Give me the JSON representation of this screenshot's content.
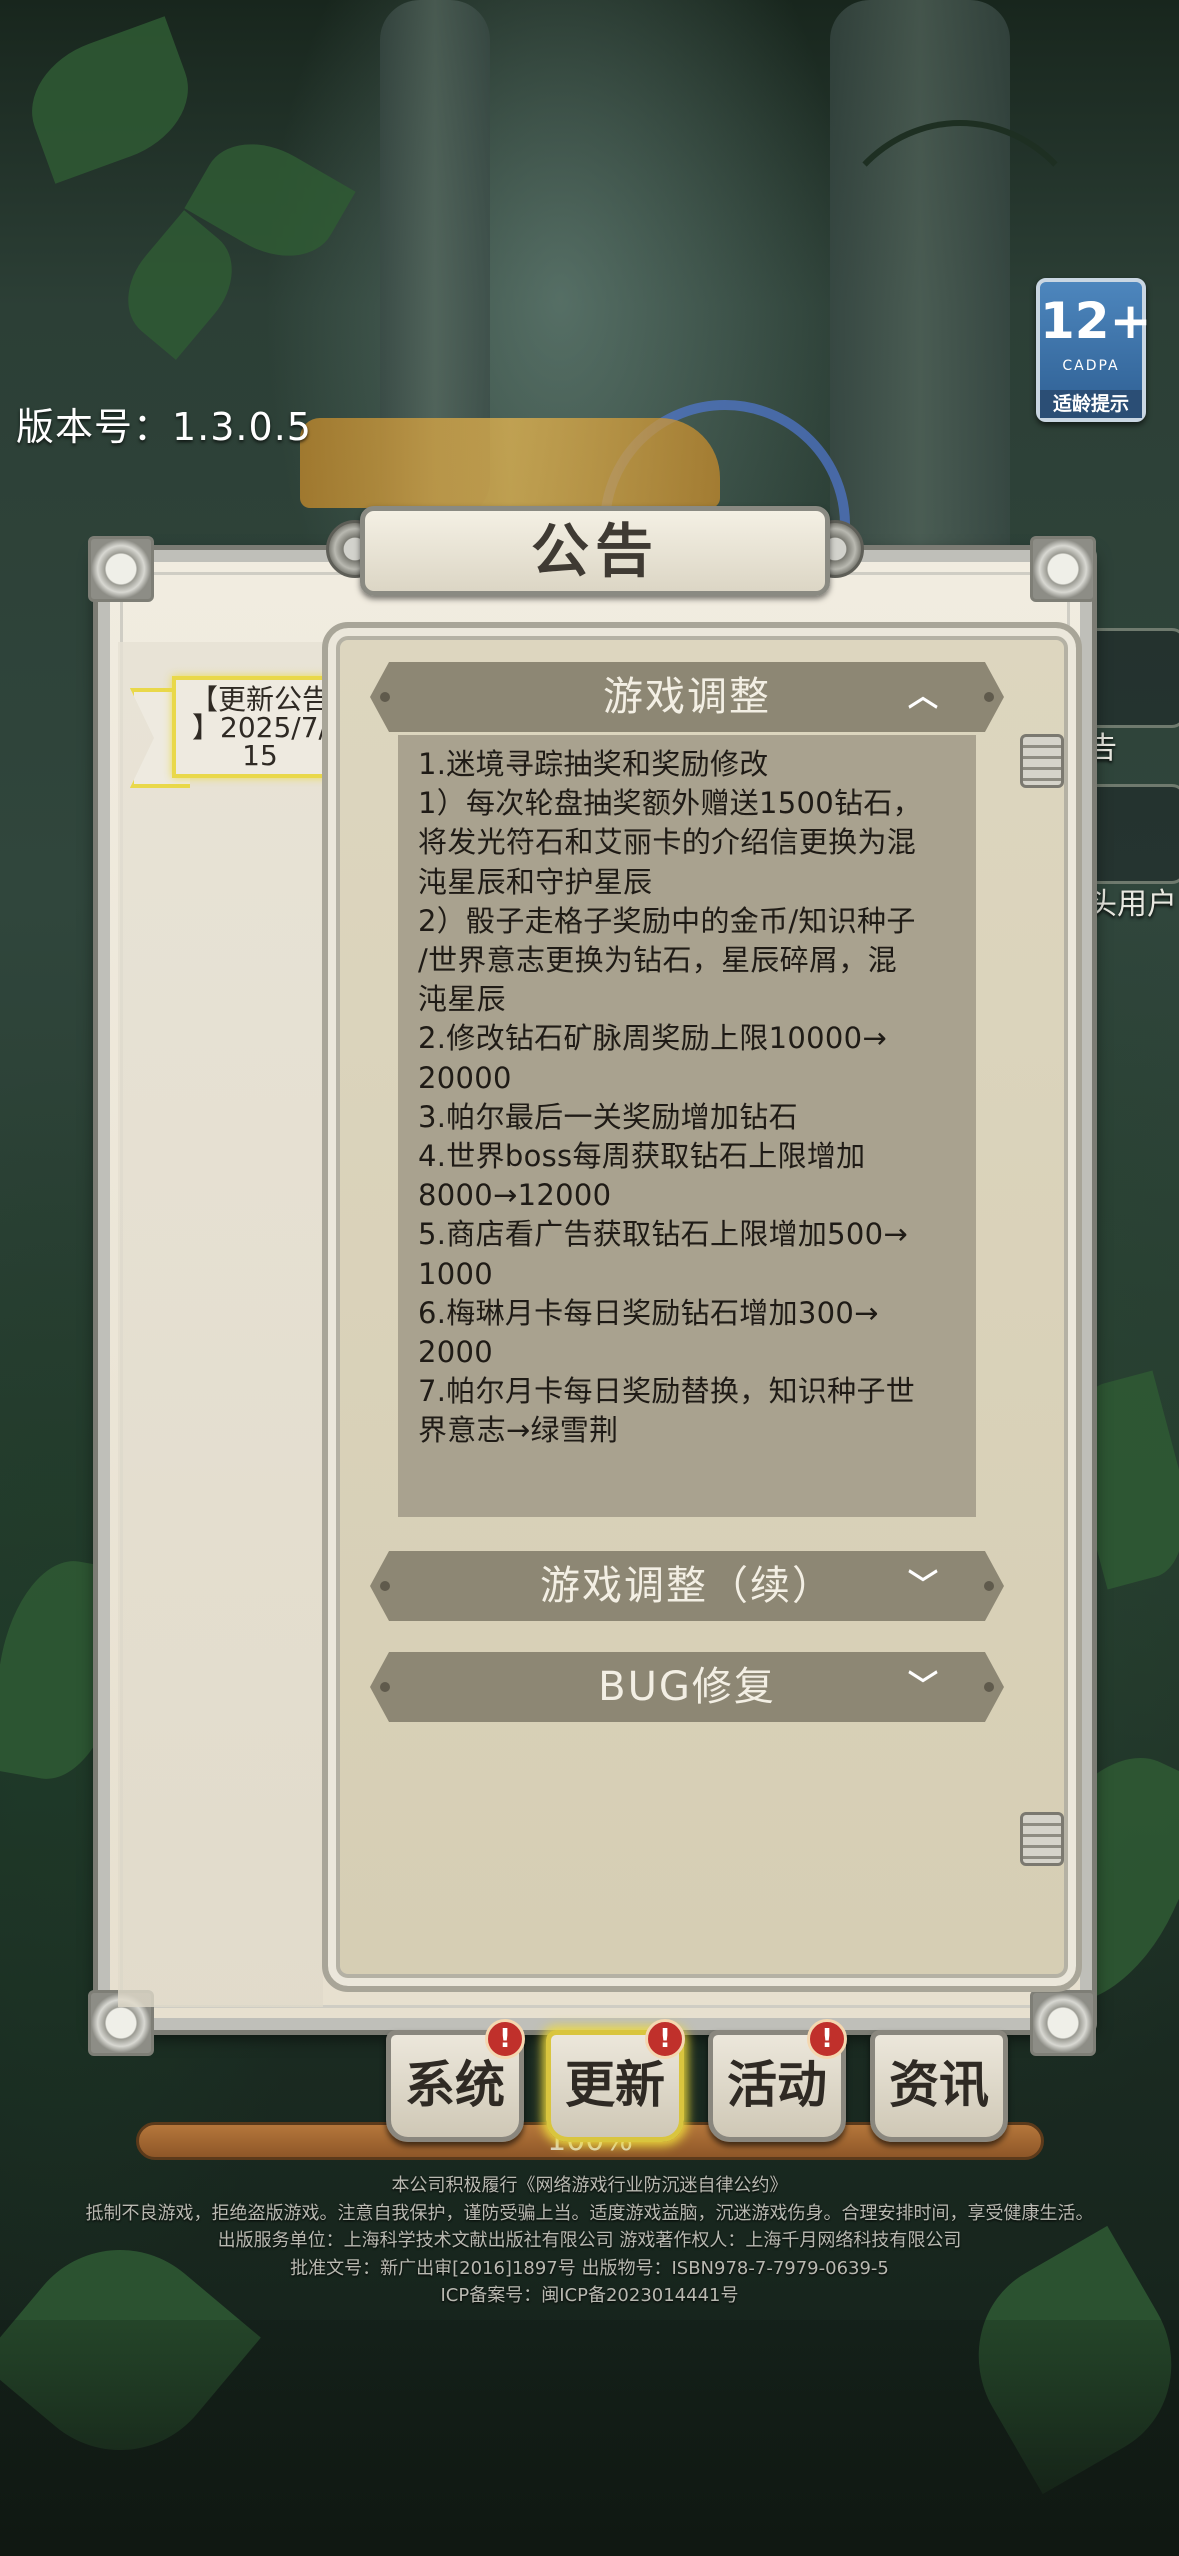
{
  "version_text": "版本号：1.3.0.5",
  "age_rating": {
    "number": "12+",
    "org": "CADPA",
    "label": "适龄提示"
  },
  "side_buttons": [
    "告",
    "头用户"
  ],
  "dialog": {
    "title": "公告",
    "tab": {
      "line1": "【更新公告",
      "line2": "】2025/7/",
      "line3": "15"
    },
    "sections": [
      {
        "title": "游戏调整",
        "chevron": "︿",
        "expanded": true,
        "lines": [
          "1.迷境寻踪抽奖和奖励修改",
          "1）每次轮盘抽奖额外赠送1500钻石，",
          "将发光符石和艾丽卡的介绍信更换为混",
          "沌星辰和守护星辰",
          "2）骰子走格子奖励中的金币/知识种子",
          "/世界意志更换为钻石，星辰碎屑，混",
          "沌星辰",
          "2.修改钻石矿脉周奖励上限10000→",
          "20000",
          "3.帕尔最后一关奖励增加钻石",
          "4.世界boss每周获取钻石上限增加",
          "8000→12000",
          "5.商店看广告获取钻石上限增加500→",
          "1000",
          "6.梅琳月卡每日奖励钻石增加300→",
          "2000",
          "7.帕尔月卡每日奖励替换，知识种子世",
          "界意志→绿雪荆"
        ]
      },
      {
        "title": "游戏调整（续）",
        "chevron": "﹀",
        "expanded": false
      },
      {
        "title": "BUG修复",
        "chevron": "﹀",
        "expanded": false
      }
    ]
  },
  "bottom_tabs": [
    {
      "label": "系统",
      "badge": "!"
    },
    {
      "label": "更新",
      "badge": "!",
      "active": true
    },
    {
      "label": "活动",
      "badge": "!"
    },
    {
      "label": "资讯",
      "badge": ""
    }
  ],
  "progress": {
    "text": "100%",
    "fraction": 1.0
  },
  "footer_lines": [
    "本公司积极履行《网络游戏行业防沉迷自律公约》",
    "抵制不良游戏，拒绝盗版游戏。注意自我保护，谨防受骗上当。适度游戏益脑，沉迷游戏伤身。合理安排时间，享受健康生活。",
    "出版服务单位：上海科学技术文献出版社有限公司 游戏著作权人：上海千月网络科技有限公司",
    "批准文号：新广出审[2016]1897号 出版物号：ISBN978-7-7979-0639-5",
    "ICP备案号：闽ICP备2023014441号"
  ]
}
